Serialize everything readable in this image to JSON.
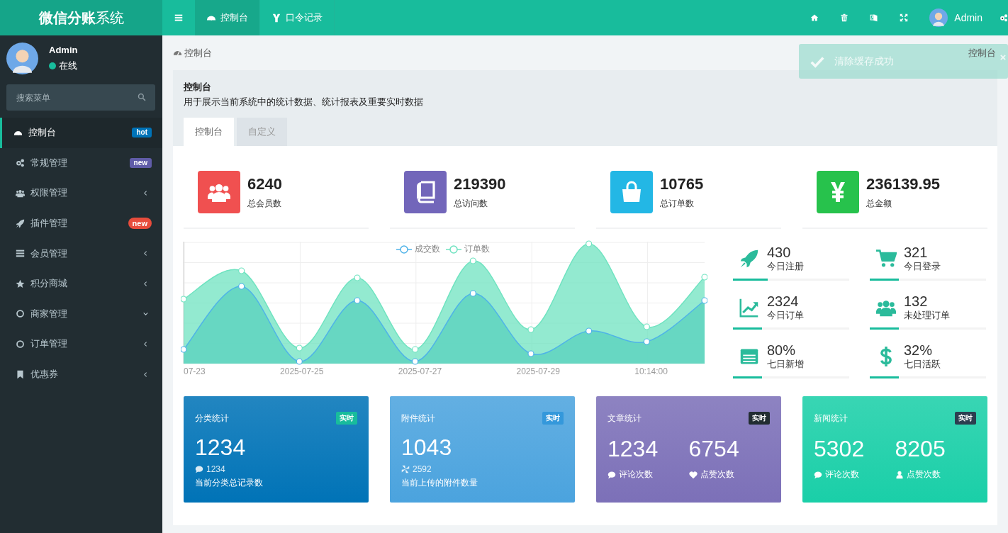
{
  "header": {
    "brand": "**微信分账**系统",
    "nav": [
      {
        "label": "控制台",
        "selected": true
      },
      {
        "label": "口令记录",
        "selected": false
      }
    ],
    "user": "Admin"
  },
  "sidebar": {
    "user": {
      "name": "Admin",
      "status": "在线"
    },
    "search": {
      "placeholder": "搜索菜单"
    },
    "menu": [
      {
        "label": "控制台",
        "selected": true,
        "badge": {
          "text": "hot",
          "color": "#0073b7"
        }
      },
      {
        "label": "常规管理",
        "selected": false,
        "badge": {
          "text": "new",
          "color": "#605ca8"
        }
      },
      {
        "label": "权限管理",
        "selected": false,
        "expanded": false
      },
      {
        "label": "插件管理",
        "selected": false,
        "badge": {
          "text": "new",
          "color": "#e74c3c",
          "kind": "pill"
        }
      },
      {
        "label": "会员管理",
        "selected": false,
        "expanded": false
      },
      {
        "label": "积分商城",
        "selected": false,
        "expanded": false
      },
      {
        "label": "商家管理",
        "selected": false,
        "expanded": true
      },
      {
        "label": "订单管理",
        "selected": false,
        "expanded": false
      },
      {
        "label": "优惠券",
        "selected": false,
        "expanded": false
      }
    ]
  },
  "breadcrumb": {
    "current": "控制台",
    "right": "控制台"
  },
  "toast": {
    "message": "清除缓存成功"
  },
  "panel": {
    "title": "控制台",
    "description": "用于展示当前系统中的统计数据、统计报表及重要实时数据",
    "tabs": [
      {
        "label": "控制台",
        "selected": true
      },
      {
        "label": "自定义",
        "selected": false
      }
    ]
  },
  "stats": [
    {
      "value": "6240",
      "label": "总会员数",
      "color": "#f05050"
    },
    {
      "value": "219390",
      "label": "总访问数",
      "color": "#7266ba"
    },
    {
      "value": "10765",
      "label": "总订单数",
      "color": "#23b7e5"
    },
    {
      "value": "236139.95",
      "label": "总金额",
      "color": "#27c24c"
    }
  ],
  "chart": {
    "legend": [
      {
        "name": "成交数",
        "color": "#4fb3e8"
      },
      {
        "name": "订单数",
        "color": "#6fe3c0"
      }
    ],
    "x_labels": [
      "07-23",
      "2025-07-25",
      "2025-07-27",
      "2025-07-29",
      "10:14:00"
    ]
  },
  "mini_stats": [
    {
      "value": "430",
      "label": "今日注册",
      "level": 0.3
    },
    {
      "value": "321",
      "label": "今日登录",
      "level": 0.25
    },
    {
      "value": "2324",
      "label": "今日订单",
      "level": 0.25
    },
    {
      "value": "132",
      "label": "未处理订单",
      "level": 0.25
    },
    {
      "value": "80%",
      "label": "七日新增",
      "level": 0.25
    },
    {
      "value": "32%",
      "label": "七日活跃",
      "level": 0.25
    }
  ],
  "cards": [
    {
      "kind": "single",
      "title": "分类统计",
      "badge": {
        "text": "实时",
        "color": "#18bc9c"
      },
      "color": "#0073b7",
      "value": "1234",
      "sub_value": "1234",
      "footer": "当前分类总记录数"
    },
    {
      "kind": "single",
      "title": "附件统计",
      "badge": {
        "text": "实时",
        "color": "#3498db"
      },
      "color": "#4ba3de",
      "value": "1043",
      "sub_value": "2592",
      "footer": "当前上传的附件数量"
    },
    {
      "kind": "double",
      "title": "文章统计",
      "badge": {
        "text": "实时",
        "color": "#222d32"
      },
      "color": "#7c70b8",
      "metrics": [
        {
          "value": "1234",
          "label": "评论次数"
        },
        {
          "value": "6754",
          "label": "点赞次数"
        }
      ]
    },
    {
      "kind": "double",
      "title": "新闻统计",
      "badge": {
        "text": "实时",
        "color": "#2c3e50"
      },
      "color": "#1acfa8",
      "metrics": [
        {
          "value": "5302",
          "label": "评论次数"
        },
        {
          "value": "8205",
          "label": "点赞次数"
        }
      ]
    }
  ]
}
